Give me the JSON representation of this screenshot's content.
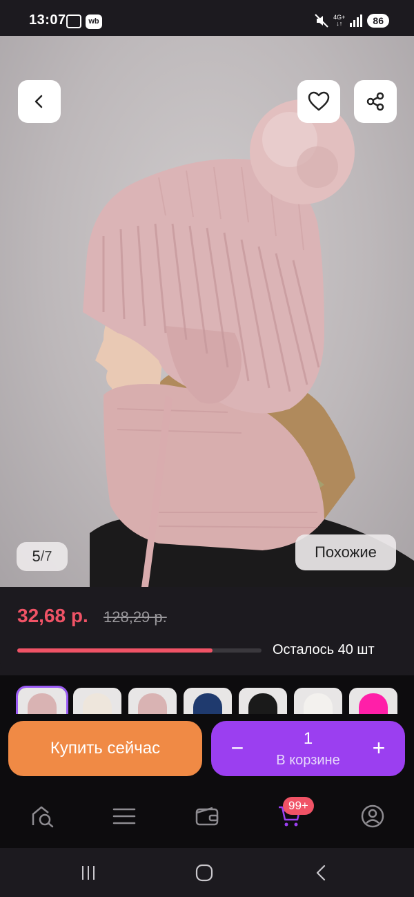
{
  "status_bar": {
    "time": "13:07",
    "app_badge": "wb",
    "network": "4G+",
    "battery": "86"
  },
  "gallery": {
    "current": "5",
    "separator": "/",
    "total": "7",
    "similar_label": "Похожие",
    "icons": {
      "back": "chevron-left-icon",
      "favorite": "heart-icon",
      "share": "share-icon"
    }
  },
  "price": {
    "current": "32,68 р.",
    "old": "128,29 р.",
    "stock_text": "Осталось 40 шт",
    "stock_fraction": 0.8,
    "accent": "#f05366"
  },
  "variants": [
    {
      "color": "#d9b3b3",
      "selected": true
    },
    {
      "color": "#eee6dc",
      "selected": false
    },
    {
      "color": "#d9b3b3",
      "selected": false
    },
    {
      "color": "#1f3a6e",
      "selected": false
    },
    {
      "color": "#1a1a1a",
      "selected": false
    },
    {
      "color": "#f3f1ee",
      "selected": false
    },
    {
      "color": "#ff1fa8",
      "selected": false
    }
  ],
  "actions": {
    "buy_now": "Купить сейчас",
    "buy_color": "#f08a45",
    "cart_color": "#9b3ff0",
    "quantity": "1",
    "in_cart": "В корзине",
    "minus": "−",
    "plus": "+"
  },
  "bottom_nav": {
    "cart_badge": "99+",
    "items": [
      "home-search-icon",
      "catalog-menu-icon",
      "wallet-icon",
      "cart-icon",
      "profile-icon"
    ]
  },
  "system_nav": {
    "items": [
      "recent-apps-icon",
      "home-icon",
      "back-icon"
    ]
  }
}
